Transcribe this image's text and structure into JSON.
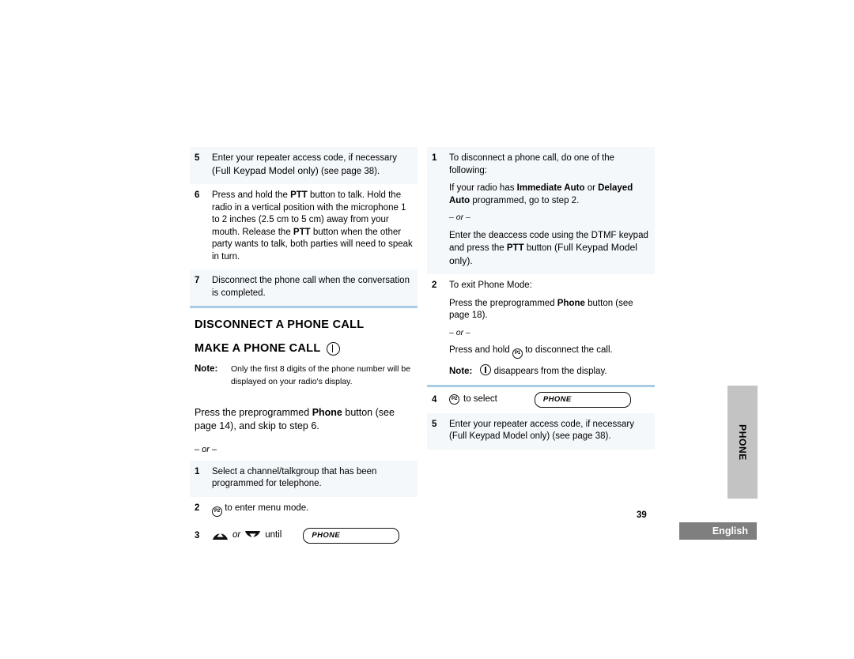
{
  "document": {
    "page_number": "39",
    "language_tab": "English",
    "side_tab_label": "PHONE"
  },
  "icons": {
    "p1": "P1",
    "p2": "P2",
    "phone_symbol": "phone-in-circle-icon",
    "up_arrow": "up-arrow-button-icon",
    "down_arrow": "down-arrow-button-icon"
  },
  "left_column": {
    "steps_top": [
      {
        "number": "5",
        "lines": [
          {
            "parts": [
              {
                "t": "Enter your repeater access code, if necessary ",
                "b": false
              },
              {
                "t": "(Full Keypad Model only)",
                "b": false,
                "size": "large"
              },
              {
                "t": " (see page 38).",
                "b": false
              }
            ]
          }
        ],
        "plain_text": "Enter your repeater access code, if necessary (Full Keypad Model only) (see page 38)."
      },
      {
        "number": "6",
        "plain_text": "Press and hold the PTT button to talk. Hold the radio in a vertical position with the microphone 1 to 2 inches (2.5 cm to 5 cm) away from your mouth. Release the PTT button when the other party wants to talk, both parties will need to speak in turn."
      },
      {
        "number": "7",
        "plain_text": "Disconnect the phone call when the conversation is completed."
      }
    ],
    "heading_1": "DISCONNECT A PHONE CALL",
    "heading_2": "MAKE A PHONE CALL",
    "note": {
      "label": "Note:",
      "text": "Only the first 8 digits of the phone number will be displayed on your radio's display."
    },
    "intro_paragraph": {
      "pre": "Press the preprogrammed ",
      "bold": "Phone",
      "post": " button (see page 14), and skip to step 6."
    },
    "or_text": "– or –",
    "steps_bottom": [
      {
        "number": "1",
        "plain_text": "Select a channel/talkgroup that has been programmed for telephone."
      },
      {
        "number": "2",
        "icon": "P2",
        "text_after_icon": "to enter menu mode."
      },
      {
        "number": "3",
        "icon_up": "up-arrow",
        "or": "or",
        "icon_down": "down-arrow",
        "text_after": "until",
        "display_value": "PHONE"
      }
    ]
  },
  "right_column": {
    "steps": [
      {
        "number": "1",
        "p1": "To disconnect a phone call, do one of the following:",
        "p2_pre": "If your radio has ",
        "p2_bold1": "Immediate Auto",
        "p2_mid": " or ",
        "p2_bold2": "Delayed Auto",
        "p2_post": " programmed, go to step 2.",
        "or_text": "– or –",
        "p3_pre": "Enter the deaccess code using the DTMF keypad and press the ",
        "p3_bold": "PTT",
        "p3_post": " button (Full Keypad Model only)."
      },
      {
        "number": "2",
        "p1": "To exit Phone Mode:",
        "p2_pre": "Press the preprogrammed ",
        "p2_bold": "Phone",
        "p2_post": " button (see page 18).",
        "or_text": "– or –",
        "p3_pre": "Press and hold ",
        "p3_icon": "P1",
        "p3_post": " to disconnect the call.",
        "note_label": "Note:",
        "note_text": "disappears from the display."
      }
    ],
    "step_4": {
      "number": "4",
      "icon": "P2",
      "text": "to select",
      "display_value": "PHONE"
    },
    "step_5": {
      "number": "5",
      "plain_text": "Enter your repeater access code, if necessary (Full Keypad Model only) (see page 38)."
    }
  },
  "colors": {
    "shaded_row": "#f4f8fb",
    "rule": "#a9cbe3",
    "side_tab": "#c3c3c3",
    "footer": "#7f7f7f"
  }
}
